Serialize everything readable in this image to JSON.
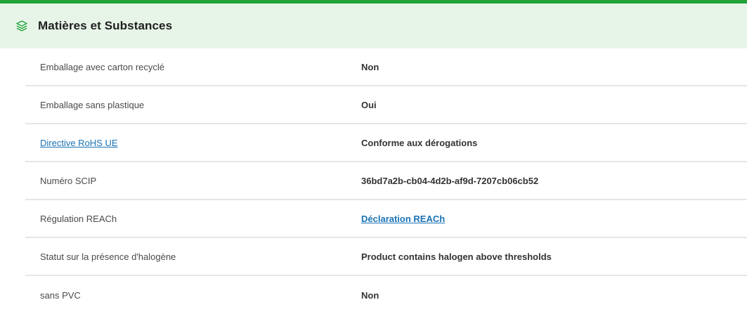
{
  "section": {
    "title": "Matières et Substances",
    "icon": "layers-icon"
  },
  "rows": [
    {
      "label": "Emballage avec carton recyclé",
      "value": "Non"
    },
    {
      "label": "Emballage sans plastique",
      "value": "Oui"
    },
    {
      "label": "Directive RoHS UE",
      "value": "Conforme aux dérogations"
    },
    {
      "label": "Numéro SCIP",
      "value": "36bd7a2b-cb04-4d2b-af9d-7207cb06cb52"
    },
    {
      "label": "Régulation REACh",
      "value": "Déclaration REACh"
    },
    {
      "label": "Statut sur la présence d'halogène",
      "value": "Product contains halogen above thresholds"
    },
    {
      "label": "sans PVC",
      "value": "Non"
    }
  ],
  "colors": {
    "accent": "#22a33a",
    "header_bg": "#e7f5e9",
    "link": "#1a73b5"
  }
}
